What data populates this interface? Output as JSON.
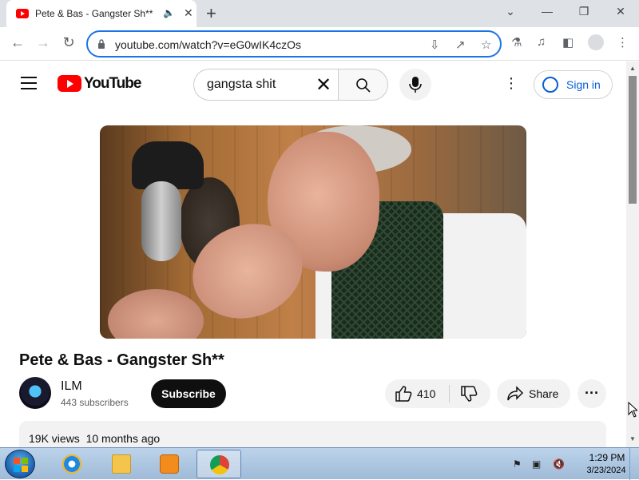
{
  "browser": {
    "tab_title": "Pete & Bas - Gangster Sh**",
    "url": "youtube.com/watch?v=eG0wIK4czOs"
  },
  "youtube": {
    "logo_text": "YouTube",
    "search_query": "gangsta shit",
    "sign_in_label": "Sign in"
  },
  "video": {
    "title": "Pete & Bas - Gangster Sh**",
    "channel_name": "ILM",
    "subscribers": "443 subscribers",
    "subscribe_label": "Subscribe",
    "like_count": "410",
    "share_label": "Share",
    "views": "19K views",
    "age": "10 months ago"
  },
  "taskbar": {
    "time": "1:29 PM",
    "date": "3/23/2024"
  },
  "colors": {
    "youtube_red": "#ff0000",
    "focus_blue": "#1a73e8",
    "signin_blue": "#065fd4"
  }
}
